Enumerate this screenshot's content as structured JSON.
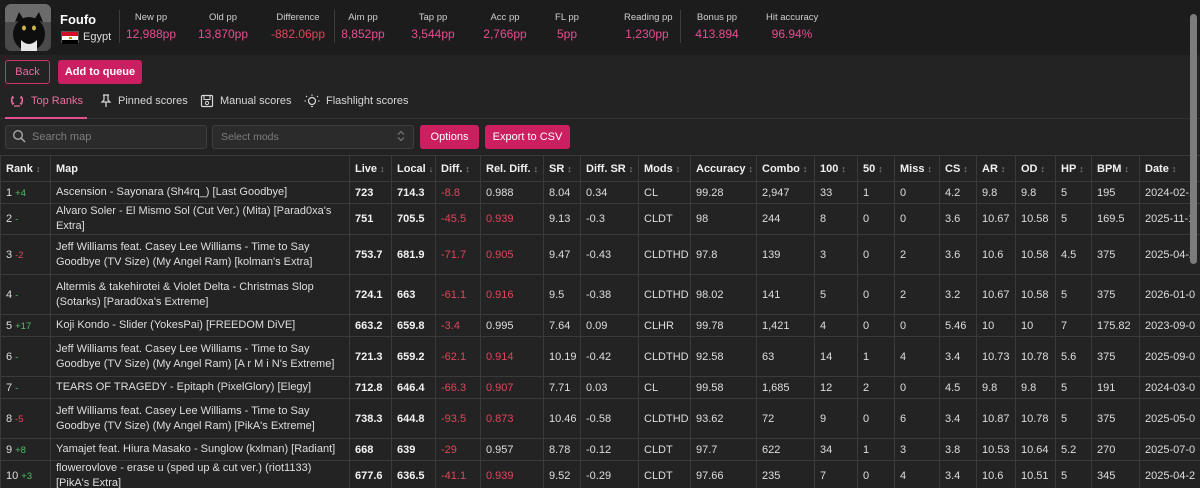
{
  "profile": {
    "username": "Foufo",
    "country": "Egypt"
  },
  "stats": [
    {
      "label": "New pp",
      "value": "12,988pp",
      "negative": false
    },
    {
      "label": "Old pp",
      "value": "13,870pp",
      "negative": false
    },
    {
      "label": "Difference",
      "value": "-882.06pp",
      "negative": true
    },
    {
      "label": "Aim pp",
      "value": "8,852pp",
      "negative": false
    },
    {
      "label": "Tap pp",
      "value": "3,544pp",
      "negative": false
    },
    {
      "label": "Acc pp",
      "value": "2,766pp",
      "negative": false
    },
    {
      "label": "FL pp",
      "value": "5pp",
      "negative": false
    },
    {
      "label": "Reading pp",
      "value": "1,230pp",
      "negative": false
    },
    {
      "label": "Bonus pp",
      "value": "413.894",
      "negative": false
    },
    {
      "label": "Hit accuracy",
      "value": "96.94%",
      "negative": false
    }
  ],
  "actions": {
    "back": "Back",
    "add_to_queue": "Add to queue",
    "options": "Options",
    "export_csv": "Export to CSV"
  },
  "tabs": [
    {
      "label": "Top Ranks",
      "icon": "laurel-icon",
      "active": true
    },
    {
      "label": "Pinned scores",
      "icon": "pin-icon",
      "active": false
    },
    {
      "label": "Manual scores",
      "icon": "save-icon",
      "active": false
    },
    {
      "label": "Flashlight scores",
      "icon": "lightbulb-icon",
      "active": false
    }
  ],
  "search": {
    "placeholder": "Search map"
  },
  "mods_select": {
    "placeholder": "Select mods"
  },
  "accent_color": "#cc1f62",
  "table": {
    "columns": [
      "Rank",
      "Map",
      "Live",
      "Local",
      "Diff.",
      "Rel. Diff.",
      "SR",
      "Diff. SR",
      "Mods",
      "Accuracy",
      "Combo",
      "100",
      "50",
      "Miss",
      "CS",
      "AR",
      "OD",
      "HP",
      "BPM",
      "Date"
    ],
    "rows": [
      {
        "rank": "1",
        "change": "+4",
        "dir": "up",
        "map": "Ascension - Sayonara (Sh4rq_) [Last Goodbye]",
        "live": "723",
        "local": "714.3",
        "diff": "-8.8",
        "rel": "0.988",
        "sr": "8.04",
        "dsr": "0.34",
        "mods": "CL",
        "acc": "99.28",
        "combo": "2,947",
        "c100": "33",
        "c50": "1",
        "miss": "0",
        "cs": "4.2",
        "ar": "9.8",
        "od": "9.8",
        "hp": "5",
        "bpm": "195",
        "date": "2024-02-1",
        "tall": false
      },
      {
        "rank": "2",
        "change": "-",
        "dir": "none",
        "map": "Alvaro Soler - El Mismo Sol (Cut Ver.) (Mita) [Parad0xa's Extra]",
        "live": "751",
        "local": "705.5",
        "diff": "-45.5",
        "rel": "0.939",
        "sr": "9.13",
        "dsr": "-0.3",
        "mods": "CLDT",
        "acc": "98",
        "combo": "244",
        "c100": "8",
        "c50": "0",
        "miss": "0",
        "cs": "3.6",
        "ar": "10.67",
        "od": "10.58",
        "hp": "5",
        "bpm": "169.5",
        "date": "2025-11-1",
        "tall": false
      },
      {
        "rank": "3",
        "change": "-2",
        "dir": "down",
        "map": "Jeff Williams feat. Casey Lee Williams - Time to Say Goodbye (TV Size) (My Angel Ram) [kolman's Extra]",
        "live": "753.7",
        "local": "681.9",
        "diff": "-71.7",
        "rel": "0.905",
        "sr": "9.47",
        "dsr": "-0.43",
        "mods": "CLDTHD",
        "acc": "97.8",
        "combo": "139",
        "c100": "3",
        "c50": "0",
        "miss": "2",
        "cs": "3.6",
        "ar": "10.6",
        "od": "10.58",
        "hp": "4.5",
        "bpm": "375",
        "date": "2025-04-2",
        "tall": true
      },
      {
        "rank": "4",
        "change": "-",
        "dir": "none",
        "map": "Altermis & takehirotei & Violet Delta - Christmas Slop (Sotarks) [Parad0xa's Extreme]",
        "live": "724.1",
        "local": "663",
        "diff": "-61.1",
        "rel": "0.916",
        "sr": "9.5",
        "dsr": "-0.38",
        "mods": "CLDTHD",
        "acc": "98.02",
        "combo": "141",
        "c100": "5",
        "c50": "0",
        "miss": "2",
        "cs": "3.2",
        "ar": "10.67",
        "od": "10.58",
        "hp": "5",
        "bpm": "375",
        "date": "2026-01-0",
        "tall": true
      },
      {
        "rank": "5",
        "change": "+17",
        "dir": "up",
        "map": "Koji Kondo - Slider (YokesPai) [FREEDOM DiVE]",
        "live": "663.2",
        "local": "659.8",
        "diff": "-3.4",
        "rel": "0.995",
        "sr": "7.64",
        "dsr": "0.09",
        "mods": "CLHR",
        "acc": "99.78",
        "combo": "1,421",
        "c100": "4",
        "c50": "0",
        "miss": "0",
        "cs": "5.46",
        "ar": "10",
        "od": "10",
        "hp": "7",
        "bpm": "175.82",
        "date": "2023-09-0",
        "tall": false
      },
      {
        "rank": "6",
        "change": "-",
        "dir": "none",
        "map": "Jeff Williams feat. Casey Lee Williams - Time to Say Goodbye (TV Size) (My Angel Ram) [A r M i N's Extreme]",
        "live": "721.3",
        "local": "659.2",
        "diff": "-62.1",
        "rel": "0.914",
        "sr": "10.19",
        "dsr": "-0.42",
        "mods": "CLDTHD",
        "acc": "92.58",
        "combo": "63",
        "c100": "14",
        "c50": "1",
        "miss": "4",
        "cs": "3.4",
        "ar": "10.73",
        "od": "10.78",
        "hp": "5.6",
        "bpm": "375",
        "date": "2025-09-0",
        "tall": true
      },
      {
        "rank": "7",
        "change": "-",
        "dir": "none",
        "map": "TEARS OF TRAGEDY - Epitaph (PixelGlory) [Elegy]",
        "live": "712.8",
        "local": "646.4",
        "diff": "-66.3",
        "rel": "0.907",
        "sr": "7.71",
        "dsr": "0.03",
        "mods": "CL",
        "acc": "99.58",
        "combo": "1,685",
        "c100": "12",
        "c50": "2",
        "miss": "0",
        "cs": "4.5",
        "ar": "9.8",
        "od": "9.8",
        "hp": "5",
        "bpm": "191",
        "date": "2024-03-0",
        "tall": false
      },
      {
        "rank": "8",
        "change": "-5",
        "dir": "down",
        "map": "Jeff Williams feat. Casey Lee Williams - Time to Say Goodbye (TV Size) (My Angel Ram) [PikA's Extreme]",
        "live": "738.3",
        "local": "644.8",
        "diff": "-93.5",
        "rel": "0.873",
        "sr": "10.46",
        "dsr": "-0.58",
        "mods": "CLDTHD",
        "acc": "93.62",
        "combo": "72",
        "c100": "9",
        "c50": "0",
        "miss": "6",
        "cs": "3.4",
        "ar": "10.87",
        "od": "10.78",
        "hp": "5",
        "bpm": "375",
        "date": "2025-05-0",
        "tall": true
      },
      {
        "rank": "9",
        "change": "+8",
        "dir": "up",
        "map": "Yamajet feat. Hiura Masako - Sunglow (kxlman) [Radiant]",
        "live": "668",
        "local": "639",
        "diff": "-29",
        "rel": "0.957",
        "sr": "8.78",
        "dsr": "-0.12",
        "mods": "CLDT",
        "acc": "97.7",
        "combo": "622",
        "c100": "34",
        "c50": "1",
        "miss": "3",
        "cs": "3.8",
        "ar": "10.53",
        "od": "10.64",
        "hp": "5.2",
        "bpm": "270",
        "date": "2025-07-0",
        "tall": false
      },
      {
        "rank": "10",
        "change": "+3",
        "dir": "up",
        "map": "flowerovlove - erase u (sped up & cut ver.) (riot1133) [PikA's Extra]",
        "live": "677.6",
        "local": "636.5",
        "diff": "-41.1",
        "rel": "0.939",
        "sr": "9.52",
        "dsr": "-0.29",
        "mods": "CLDT",
        "acc": "97.66",
        "combo": "235",
        "c100": "7",
        "c50": "0",
        "miss": "4",
        "cs": "3.4",
        "ar": "10.6",
        "od": "10.51",
        "hp": "5",
        "bpm": "345",
        "date": "2025-04-2",
        "tall": false
      }
    ]
  }
}
